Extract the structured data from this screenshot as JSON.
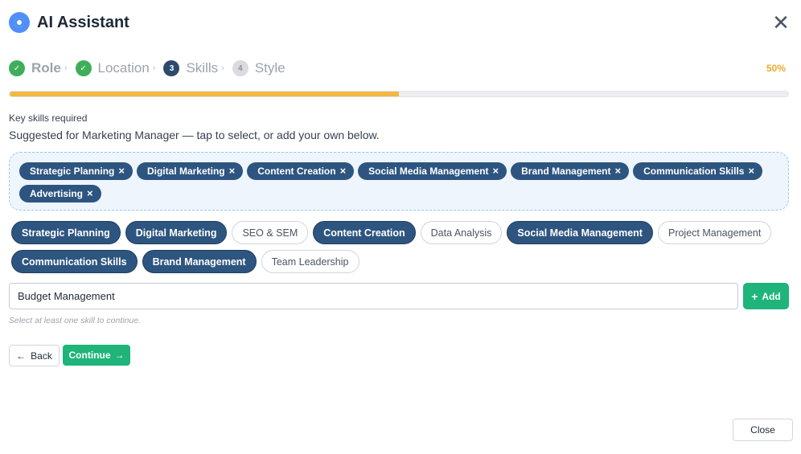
{
  "header": {
    "title": "AI Assistant",
    "logo_icon": "assistant-logo-icon",
    "close_symbol": "✕",
    "accent_color": "#4f8ff7"
  },
  "steps": [
    {
      "number": "✓",
      "label": "Role",
      "state": "done",
      "separator": "›"
    },
    {
      "number": "✓",
      "label": "Location",
      "state": "done",
      "separator": "›"
    },
    {
      "number": "3",
      "label": "Skills",
      "state": "current",
      "separator": "›"
    },
    {
      "number": "4",
      "label": "Style",
      "state": "pending",
      "separator": ""
    }
  ],
  "progress": {
    "percent_label": "50%",
    "fraction": 0.5,
    "color": "#f2b843"
  },
  "question": {
    "label": "Key skills required",
    "hint": "Suggested for Marketing Manager — tap to select, or add your own below."
  },
  "selected_skills": {
    "remove_symbol": "×",
    "items": [
      "Strategic Planning",
      "Digital Marketing",
      "Content Creation",
      "Social Media Management",
      "Brand Management",
      "Communication Skills",
      "Advertising"
    ]
  },
  "suggestions": [
    {
      "label": "Strategic Planning",
      "selected": true
    },
    {
      "label": "Digital Marketing",
      "selected": true
    },
    {
      "label": "SEO & SEM",
      "selected": false
    },
    {
      "label": "Content Creation",
      "selected": true
    },
    {
      "label": "Data Analysis",
      "selected": false
    },
    {
      "label": "Social Media Management",
      "selected": true
    },
    {
      "label": "Project Management",
      "selected": false
    },
    {
      "label": "Communication Skills",
      "selected": true
    },
    {
      "label": "Brand Management",
      "selected": true
    },
    {
      "label": "Team Leadership",
      "selected": false
    }
  ],
  "custom_skill": {
    "value": "Budget Management",
    "add_symbol": "+",
    "add_label": "Add",
    "helper": "Select at least one skill to continue."
  },
  "nav": {
    "back_symbol": "←",
    "back_label": "Back",
    "continue_label": "Continue",
    "continue_symbol": "→"
  },
  "footer": {
    "close_label": "Close"
  },
  "colors": {
    "chip_selected": "#2d5580",
    "primary_green": "#1fb57a",
    "step_done": "#3fae5a",
    "step_current": "#2d4a6e",
    "percent_text": "#f0a92b"
  }
}
